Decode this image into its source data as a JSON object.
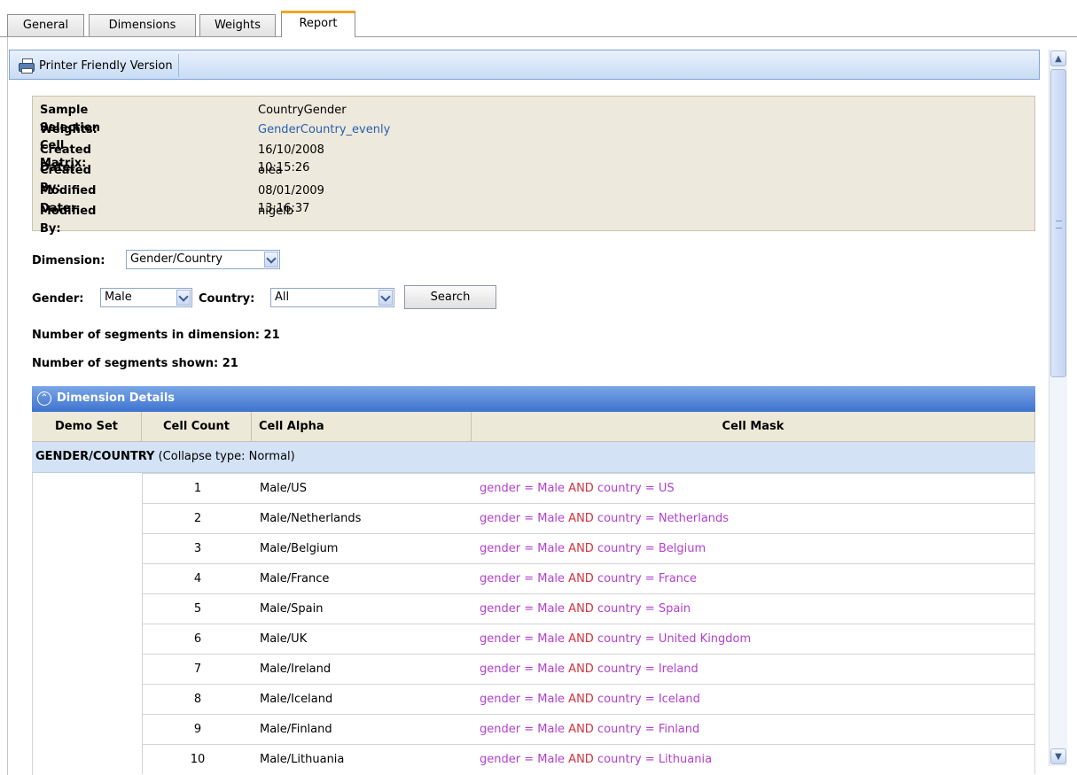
{
  "tabs": [
    {
      "label": "General",
      "active": false
    },
    {
      "label": "Dimensions",
      "active": false
    },
    {
      "label": "Weights",
      "active": false
    },
    {
      "label": "Report",
      "active": true
    }
  ],
  "toolbar": {
    "printer_label": "Printer Friendly Version"
  },
  "info": {
    "sample_selection_label": "Sample Selection Cell Matrix:",
    "sample_selection_value": "CountryGender",
    "weights_label": "Weights:",
    "weights_value": "GenderCountry_evenly",
    "created_date_label": "Created Date:",
    "created_date_value": "16/10/2008 10:15:26",
    "created_by_label": "Created By:",
    "created_by_value": "olea",
    "modified_date_label": "Modified Date:",
    "modified_date_value": "08/01/2009 13:16:37",
    "modified_by_label": "Modified By:",
    "modified_by_value": "nigelb"
  },
  "filters": {
    "dimension_label": "Dimension:",
    "dimension_value": "Gender/Country",
    "gender_label": "Gender:",
    "gender_value": "Male",
    "country_label": "Country:",
    "country_value": "All",
    "search_label": "Search"
  },
  "stats": {
    "segments_in_dimension": "Number of segments in dimension: 21",
    "segments_shown": "Number of segments shown: 21"
  },
  "details": {
    "header": "Dimension Details",
    "columns": [
      "Demo Set",
      "Cell Count",
      "Cell Alpha",
      "Cell Mask"
    ],
    "group_name": "GENDER/COUNTRY",
    "group_note": "(Collapse type: Normal)",
    "rows": [
      {
        "count": "1",
        "alpha": "Male/US",
        "m1": "gender = Male ",
        "and": "AND",
        "m2": " country = US"
      },
      {
        "count": "2",
        "alpha": "Male/Netherlands",
        "m1": "gender = Male ",
        "and": "AND",
        "m2": " country = Netherlands"
      },
      {
        "count": "3",
        "alpha": "Male/Belgium",
        "m1": "gender = Male ",
        "and": "AND",
        "m2": " country = Belgium"
      },
      {
        "count": "4",
        "alpha": "Male/France",
        "m1": "gender = Male ",
        "and": "AND",
        "m2": " country = France"
      },
      {
        "count": "5",
        "alpha": "Male/Spain",
        "m1": "gender = Male ",
        "and": "AND",
        "m2": " country = Spain"
      },
      {
        "count": "6",
        "alpha": "Male/UK",
        "m1": "gender = Male ",
        "and": "AND",
        "m2": " country = United Kingdom"
      },
      {
        "count": "7",
        "alpha": "Male/Ireland",
        "m1": "gender = Male ",
        "and": "AND",
        "m2": " country = Ireland"
      },
      {
        "count": "8",
        "alpha": "Male/Iceland",
        "m1": "gender = Male ",
        "and": "AND",
        "m2": " country = Iceland"
      },
      {
        "count": "9",
        "alpha": "Male/Finland",
        "m1": "gender = Male ",
        "and": "AND",
        "m2": " country = Finland"
      },
      {
        "count": "10",
        "alpha": "Male/Lithuania",
        "m1": "gender = Male ",
        "and": "AND",
        "m2": " country = Lithuania"
      }
    ]
  },
  "colors": {
    "accent_tab": "#f0a526",
    "header_blue": "#3e73cf",
    "link": "#2a5db0",
    "mask_field": "#b340d0",
    "mask_op": "#d7323f"
  }
}
